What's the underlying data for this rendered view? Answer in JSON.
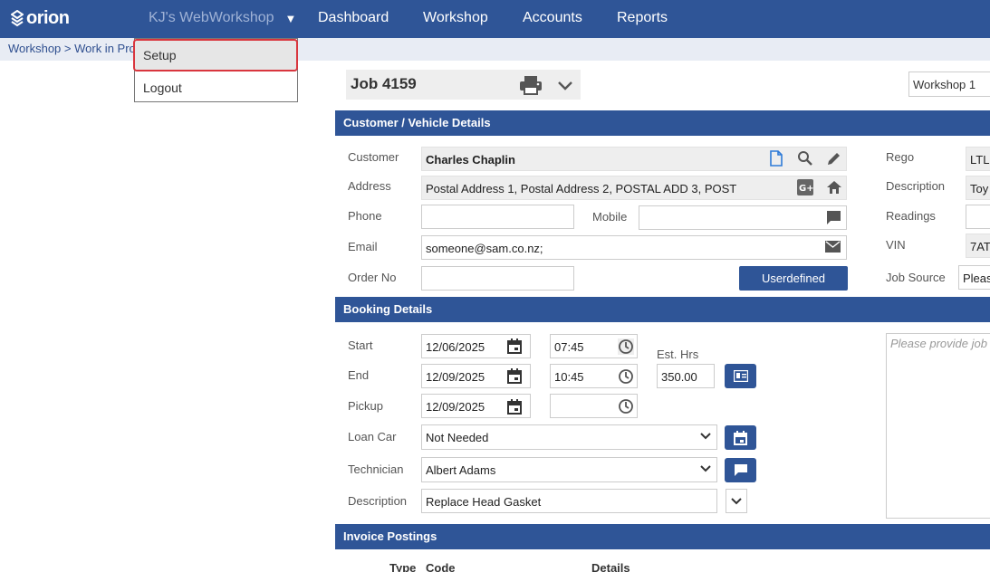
{
  "topbar": {
    "logo_text": "orion",
    "org_name": "KJ's WebWorkshop",
    "nav": [
      "Dashboard",
      "Workshop",
      "Accounts",
      "Reports"
    ]
  },
  "breadcrumb": "Workshop > Work in Pro",
  "dropdown": {
    "items": [
      "Setup",
      "Logout"
    ]
  },
  "job": {
    "title": "Job 4159",
    "workshop": "Workshop 1"
  },
  "sections": {
    "customer": "Customer / Vehicle Details",
    "booking": "Booking Details",
    "invoice": "Invoice Postings"
  },
  "customer": {
    "labels": {
      "customer": "Customer",
      "address": "Address",
      "phone": "Phone",
      "mobile": "Mobile",
      "email": "Email",
      "order_no": "Order No",
      "rego": "Rego",
      "description": "Description",
      "readings": "Readings",
      "vin": "VIN",
      "job_source": "Job Source"
    },
    "customer_name": "Charles Chaplin",
    "address": "Postal Address 1, Postal Address 2, POSTAL ADD 3, POST",
    "phone": "",
    "mobile": "",
    "email": "someone@sam.co.nz;",
    "order_no": "",
    "userdefined_label": "Userdefined",
    "rego": "LTL",
    "vehicle_description": "Toy",
    "readings": "",
    "vin": "7AT",
    "job_source": "Pleas"
  },
  "booking": {
    "labels": {
      "start": "Start",
      "end": "End",
      "pickup": "Pickup",
      "est_hrs": "Est. Hrs",
      "loan_car": "Loan Car",
      "technician": "Technician",
      "description": "Description"
    },
    "start_date": "12/06/2025",
    "start_time": "07:45",
    "end_date": "12/09/2025",
    "end_time": "10:45",
    "est_hrs": "350.00",
    "pickup_date": "12/09/2025",
    "pickup_time": "",
    "loan_car": "Not Needed",
    "technician": "Albert Adams",
    "description": "Replace Head Gasket",
    "notes_placeholder": "Please provide job"
  },
  "invoice": {
    "columns": [
      "Type",
      "Code",
      "Details"
    ]
  },
  "colors": {
    "primary": "#2f5597",
    "highlight_border": "#d9363e"
  },
  "icons": [
    "printer-icon",
    "chevron-down-icon",
    "new-document-icon",
    "search-icon",
    "edit-icon",
    "google-plus-icon",
    "home-icon",
    "message-icon",
    "mail-icon",
    "calendar-icon",
    "clock-icon",
    "contact-card-icon",
    "comment-icon"
  ]
}
